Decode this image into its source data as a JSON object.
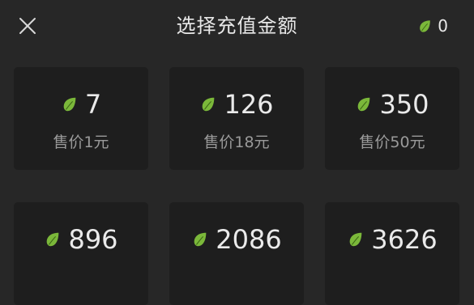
{
  "header": {
    "title": "选择充值金额",
    "balance": "0"
  },
  "colors": {
    "background": "#272727",
    "card": "#1e1e1e",
    "leaf_green": "#7bb83a"
  },
  "icons": {
    "close": "close-icon",
    "currency": "leaf-icon"
  },
  "options": [
    {
      "amount": "7",
      "price": "售价1元"
    },
    {
      "amount": "126",
      "price": "售价18元"
    },
    {
      "amount": "350",
      "price": "售价50元"
    },
    {
      "amount": "896",
      "price": ""
    },
    {
      "amount": "2086",
      "price": ""
    },
    {
      "amount": "3626",
      "price": ""
    }
  ]
}
